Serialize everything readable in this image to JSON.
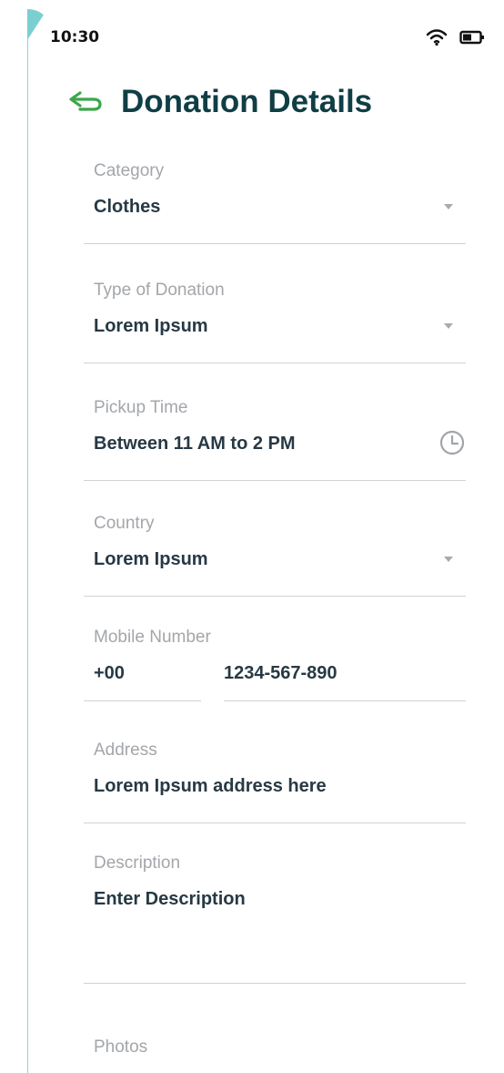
{
  "status": {
    "time": "10:30",
    "icons": [
      "wifi-icon",
      "battery-icon"
    ]
  },
  "header": {
    "back_icon": "back-arrow-icon",
    "title": "Donation Details"
  },
  "fields": {
    "category": {
      "label": "Category",
      "value": "Clothes",
      "icon": "chevron-down-icon"
    },
    "type": {
      "label": "Type of Donation",
      "value": "Lorem Ipsum",
      "icon": "chevron-down-icon"
    },
    "pickup": {
      "label": "Pickup Time",
      "value": "Between 11 AM to 2 PM",
      "icon": "clock-icon"
    },
    "country": {
      "label": "Country",
      "value": "Lorem Ipsum",
      "icon": "chevron-down-icon"
    },
    "mobile": {
      "label": "Mobile Number",
      "code": "+00",
      "number": "1234-567-890"
    },
    "address": {
      "label": "Address",
      "value": "Lorem Ipsum address here"
    },
    "description": {
      "label": "Description",
      "placeholder": "Enter Description"
    },
    "photos": {
      "label": "Photos"
    }
  },
  "colors": {
    "title": "#103e45",
    "back_icon": "#39a74a",
    "text": "#273944",
    "muted_label": "#a3a6aa",
    "divider": "#cfd3d5",
    "accent": "#7ccfd0"
  }
}
